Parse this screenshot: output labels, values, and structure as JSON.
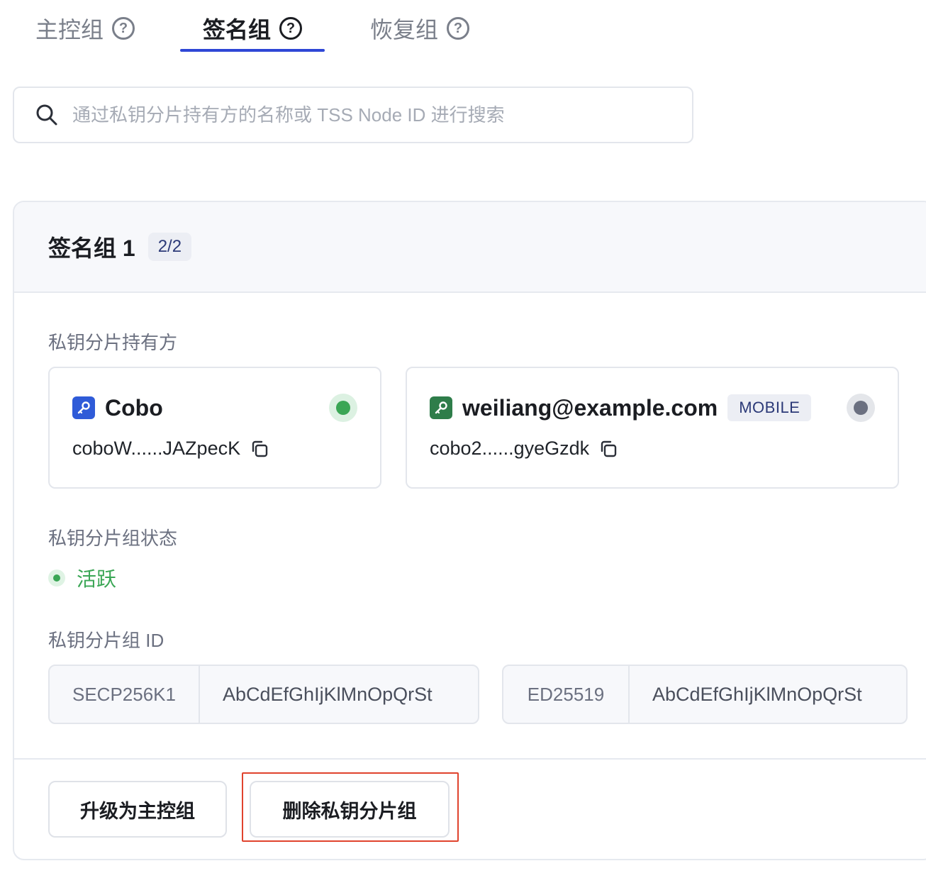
{
  "tabs": [
    {
      "label": "主控组",
      "help": "?"
    },
    {
      "label": "签名组",
      "help": "?"
    },
    {
      "label": "恢复组",
      "help": "?"
    }
  ],
  "search": {
    "placeholder": "通过私钥分片持有方的名称或 TSS Node ID 进行搜索"
  },
  "group": {
    "title": "签名组 1",
    "count": "2/2",
    "holders_label": "私钥分片持有方",
    "holders": [
      {
        "name": "Cobo",
        "node_id": "coboW......JAZpecK",
        "icon_color": "#2f5bd8",
        "status_color": "#3aa655"
      },
      {
        "name": "weiliang@example.com",
        "tag": "MOBILE",
        "node_id": "cobo2......gyeGzdk",
        "icon_color": "#2e7d4a",
        "status_color": "#6b7080"
      }
    ],
    "state_label": "私钥分片组状态",
    "state_value": "活跃",
    "id_label": "私钥分片组 ID",
    "ids": [
      {
        "algo": "SECP256K1",
        "value": "AbCdEfGhIjKlMnOpQrSt"
      },
      {
        "algo": "ED25519",
        "value": "AbCdEfGhIjKlMnOpQrSt"
      }
    ],
    "actions": {
      "upgrade": "升级为主控组",
      "delete": "删除私钥分片组"
    }
  },
  "colors": {
    "accent": "#2f47d6",
    "active_green": "#3aa655",
    "highlight": "#e0432d"
  }
}
